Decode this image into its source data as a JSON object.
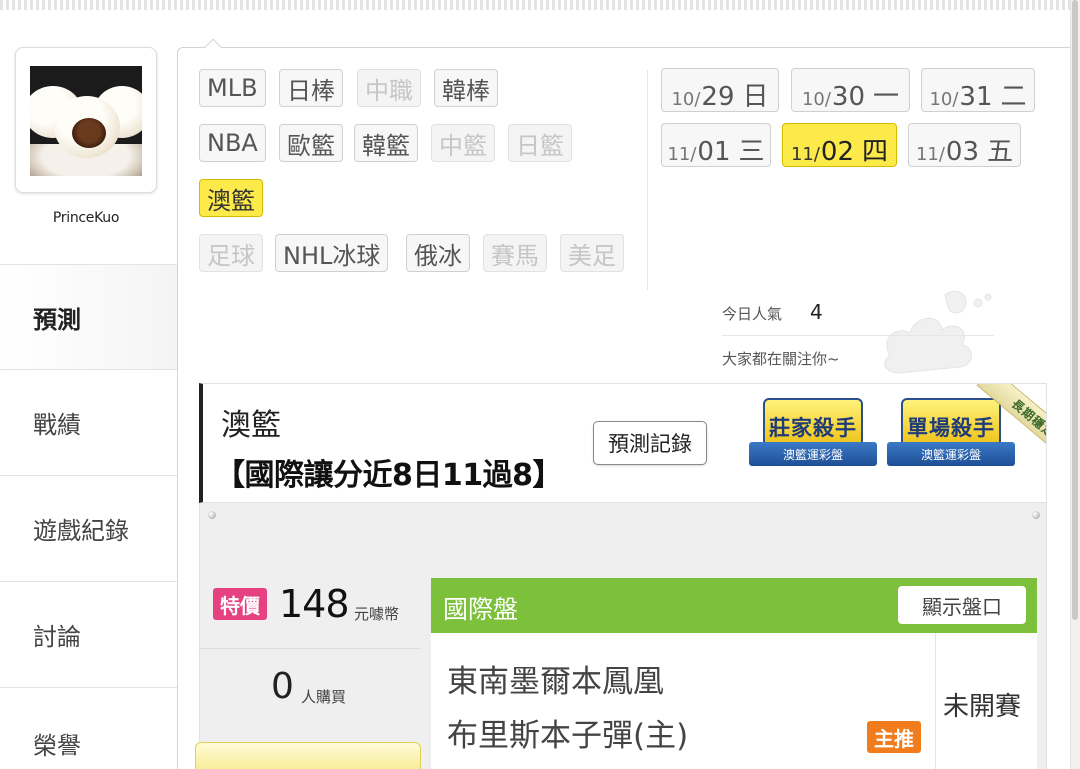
{
  "user": {
    "name": "PrinceKuo"
  },
  "side_nav": [
    {
      "label": "預測",
      "active": true
    },
    {
      "label": "戰績",
      "active": false
    },
    {
      "label": "遊戲紀錄",
      "active": false
    },
    {
      "label": "討論",
      "active": false
    },
    {
      "label": "榮譽",
      "active": false
    }
  ],
  "sports": {
    "row1": [
      {
        "label": "MLB",
        "state": "enabled"
      },
      {
        "label": "日棒",
        "state": "enabled"
      },
      {
        "label": "中職",
        "state": "disabled"
      },
      {
        "label": "韓棒",
        "state": "enabled"
      }
    ],
    "row2": [
      {
        "label": "NBA",
        "state": "enabled"
      },
      {
        "label": "歐籃",
        "state": "enabled"
      },
      {
        "label": "韓籃",
        "state": "enabled"
      },
      {
        "label": "中籃",
        "state": "disabled"
      },
      {
        "label": "日籃",
        "state": "disabled"
      }
    ],
    "row3": [
      {
        "label": "澳籃",
        "state": "active"
      }
    ],
    "row4": [
      {
        "label": "足球",
        "state": "disabled"
      },
      {
        "label": "NHL冰球",
        "state": "enabled"
      },
      {
        "label": "俄冰",
        "state": "enabled"
      },
      {
        "label": "賽馬",
        "state": "disabled"
      },
      {
        "label": "美足",
        "state": "disabled"
      }
    ]
  },
  "dates": [
    {
      "month": "10/",
      "day": "29",
      "weekday": "日",
      "active": false
    },
    {
      "month": "10/",
      "day": "30",
      "weekday": "一",
      "active": false
    },
    {
      "month": "10/",
      "day": "31",
      "weekday": "二",
      "active": false
    },
    {
      "month": "11/",
      "day": "01",
      "weekday": "三",
      "active": false
    },
    {
      "month": "11/",
      "day": "02",
      "weekday": "四",
      "active": true
    },
    {
      "month": "11/",
      "day": "03",
      "weekday": "五",
      "active": false
    }
  ],
  "popularity": {
    "label": "今日人氣",
    "value": "4",
    "note": "大家都在關注你~"
  },
  "league": {
    "title": "澳籃",
    "subtitle": "【國際讓分近8日11過8】",
    "record_button": "預測記錄",
    "badges": [
      {
        "title": "莊家殺手",
        "ribbon": "澳籃運彩盤"
      },
      {
        "title": "單場殺手",
        "ribbon": "澳籃運彩盤"
      }
    ],
    "corner_ribbon": "長期穩定"
  },
  "price": {
    "tag": "特價",
    "value": "148",
    "unit": "元噱幣",
    "buyers": "0",
    "buyers_label": "人購買"
  },
  "game": {
    "header": "國際盤",
    "show_odds": "顯示盤口",
    "team_away": "東南墨爾本鳳凰",
    "team_home": "布里斯本子彈(主)",
    "main_tag": "主推",
    "status": "未開賽"
  },
  "colors": {
    "active_yellow": "#fce94a",
    "game_header_green": "#7cc03c",
    "sale_pink": "#e64180",
    "main_tag_orange": "#f17c1d"
  }
}
